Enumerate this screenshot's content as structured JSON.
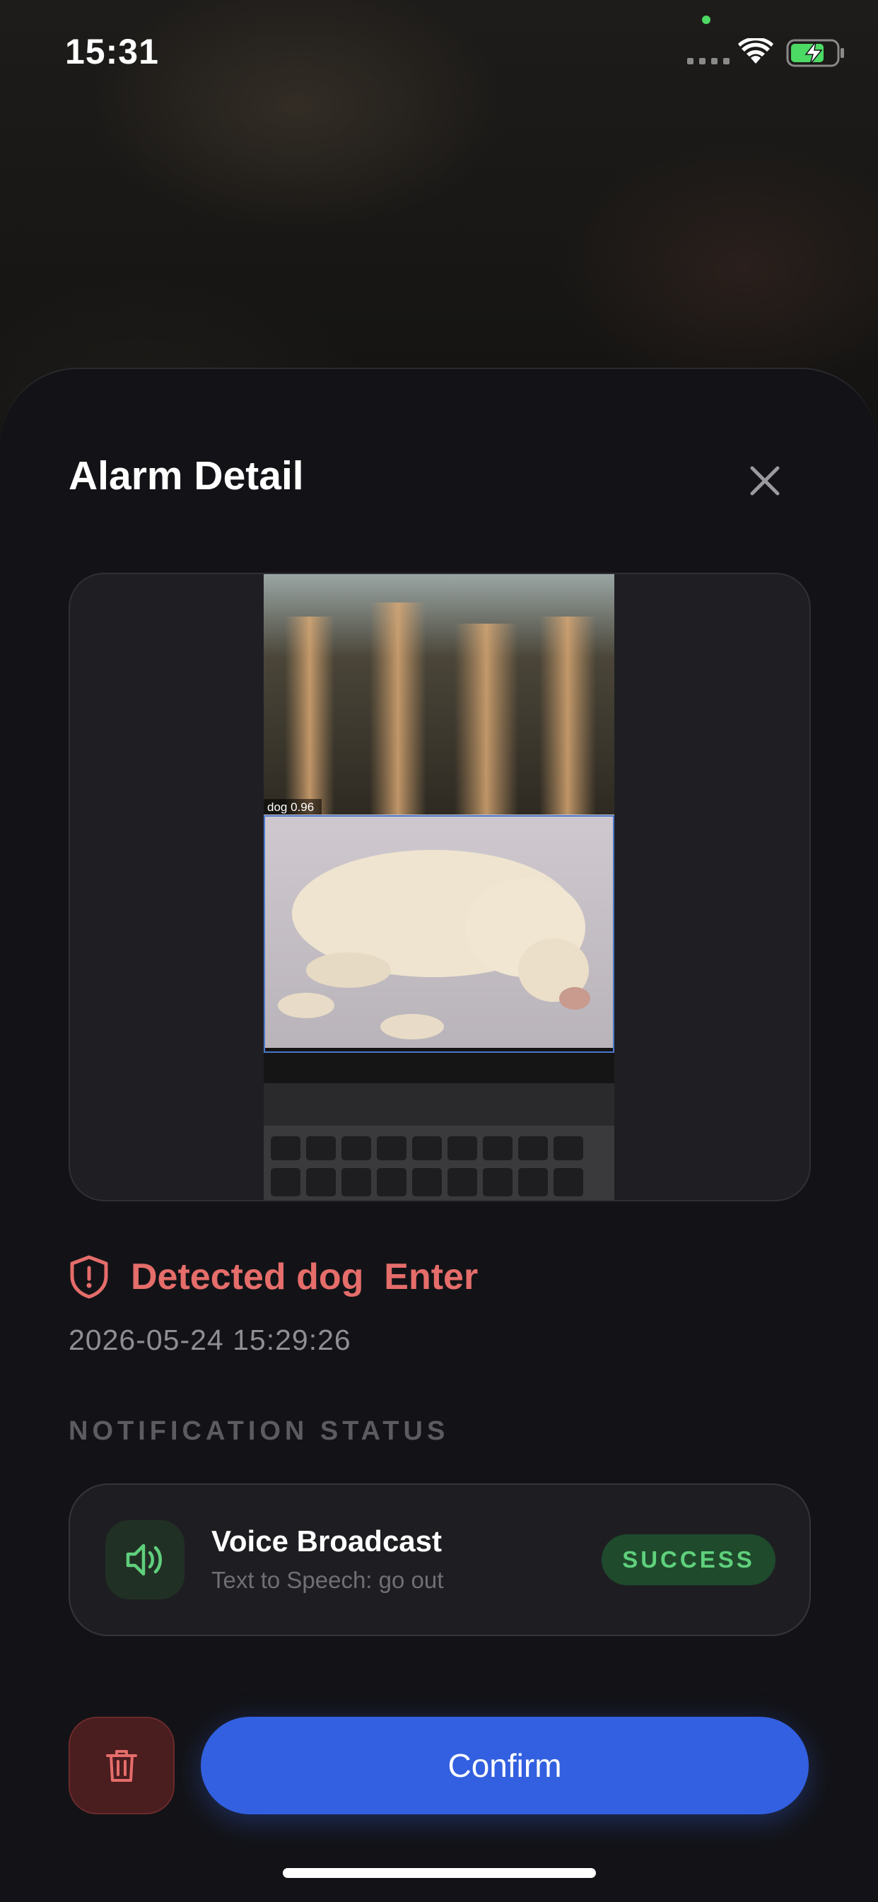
{
  "status_bar": {
    "time": "15:31",
    "icons": [
      "recording-dot-icon",
      "cellular-signal-icon",
      "wifi-icon",
      "battery-charging-icon"
    ]
  },
  "sheet": {
    "title": "Alarm Detail",
    "close_icon": "close-icon"
  },
  "snapshot": {
    "detection_label": "dog 0.96"
  },
  "alarm": {
    "icon": "shield-alert-icon",
    "title": "Detected dog  Enter",
    "timestamp": "2026-05-24 15:29:26"
  },
  "notification_section": {
    "label": "NOTIFICATION STATUS",
    "items": [
      {
        "icon": "speaker-icon",
        "title": "Voice Broadcast",
        "subtitle": "Text to Speech: go out",
        "status": "SUCCESS"
      }
    ]
  },
  "actions": {
    "delete_icon": "trash-icon",
    "confirm_label": "Confirm"
  },
  "colors": {
    "alert": "#e56d6a",
    "success_text": "#5fd07c",
    "success_bg": "#1f4a2c",
    "primary": "#3360e0",
    "delete_bg": "#4a1d1f"
  }
}
